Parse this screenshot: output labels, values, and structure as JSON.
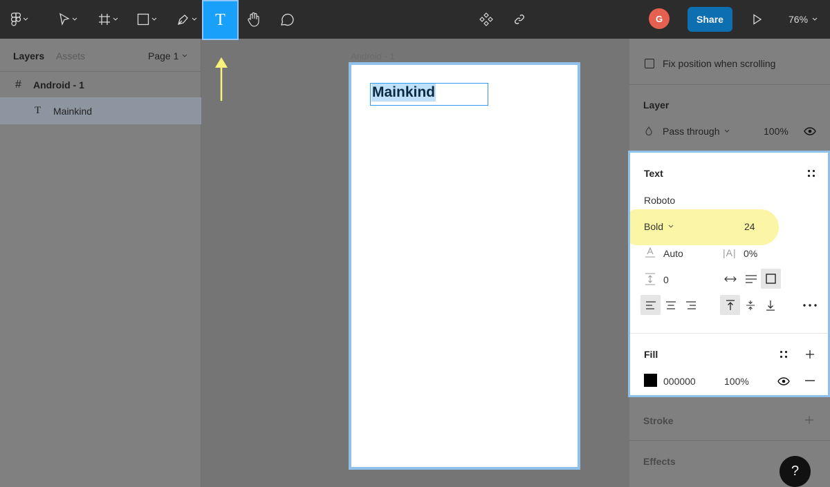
{
  "toolbar": {
    "text_tool_label": "T",
    "avatar_initial": "G",
    "share_label": "Share",
    "zoom": "76%"
  },
  "left_panel": {
    "tab_layers": "Layers",
    "tab_assets": "Assets",
    "page": "Page 1",
    "layers": [
      {
        "name": "Android - 1",
        "icon": "frame-icon"
      },
      {
        "name": "Mainkind",
        "icon": "text-layer-icon"
      }
    ]
  },
  "canvas": {
    "frame_label": "Android - 1",
    "selected_text": "Mainkind"
  },
  "right_panel": {
    "fix_position": "Fix position when scrolling",
    "layer_title": "Layer",
    "blend_mode": "Pass through",
    "layer_opacity": "100%",
    "stroke_title": "Stroke",
    "effects_title": "Effects"
  },
  "text_panel": {
    "title": "Text",
    "font_family": "Roboto",
    "font_weight": "Bold",
    "font_size": "24",
    "line_height": "Auto",
    "letter_spacing": "0%",
    "paragraph_spacing": "0"
  },
  "fill": {
    "title": "Fill",
    "hex": "000000",
    "opacity": "100%"
  },
  "help_label": "?",
  "colors": {
    "accent": "#18a0fb",
    "highlight": "#fbf6a6",
    "selection_border": "#8ec0ea"
  }
}
